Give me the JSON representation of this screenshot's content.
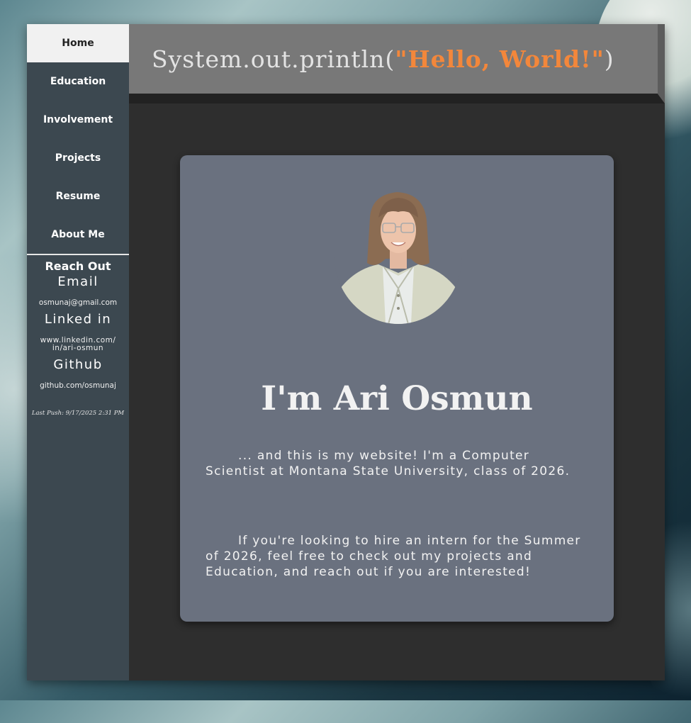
{
  "nav": {
    "items": [
      {
        "label": "Home",
        "active": true
      },
      {
        "label": "Education"
      },
      {
        "label": "Involvement"
      },
      {
        "label": "Projects"
      },
      {
        "label": "Resume"
      },
      {
        "label": "About Me"
      }
    ]
  },
  "reach": {
    "title": "Reach Out",
    "email_heading": "Email",
    "email": "osmunaj@gmail.com",
    "linkedin_heading": "Linked in",
    "linkedin_line1": "www.linkedin.com/",
    "linkedin_line2": "in/ari-osmun",
    "github_heading": "Github",
    "github": "github.com/osmunaj"
  },
  "last_push": "Last Push: 9/17/2025 2:31 PM",
  "header": {
    "code_prefix": "System.out.println(",
    "code_string": "\"Hello, World!\"",
    "code_suffix": ")"
  },
  "profile": {
    "name": "I'm Ari Osmun",
    "intro": "... and this is my website! I'm a Computer Scientist at Montana State University, class of 2026.",
    "hire": "If you're looking to hire an intern for the Summer of 2026, feel free to check out my projects and Education, and reach out if you are interested!"
  },
  "colors": {
    "accent": "#f3873b",
    "sidebar": "#3c4850",
    "card": "#6a717f",
    "header": "#787878"
  }
}
